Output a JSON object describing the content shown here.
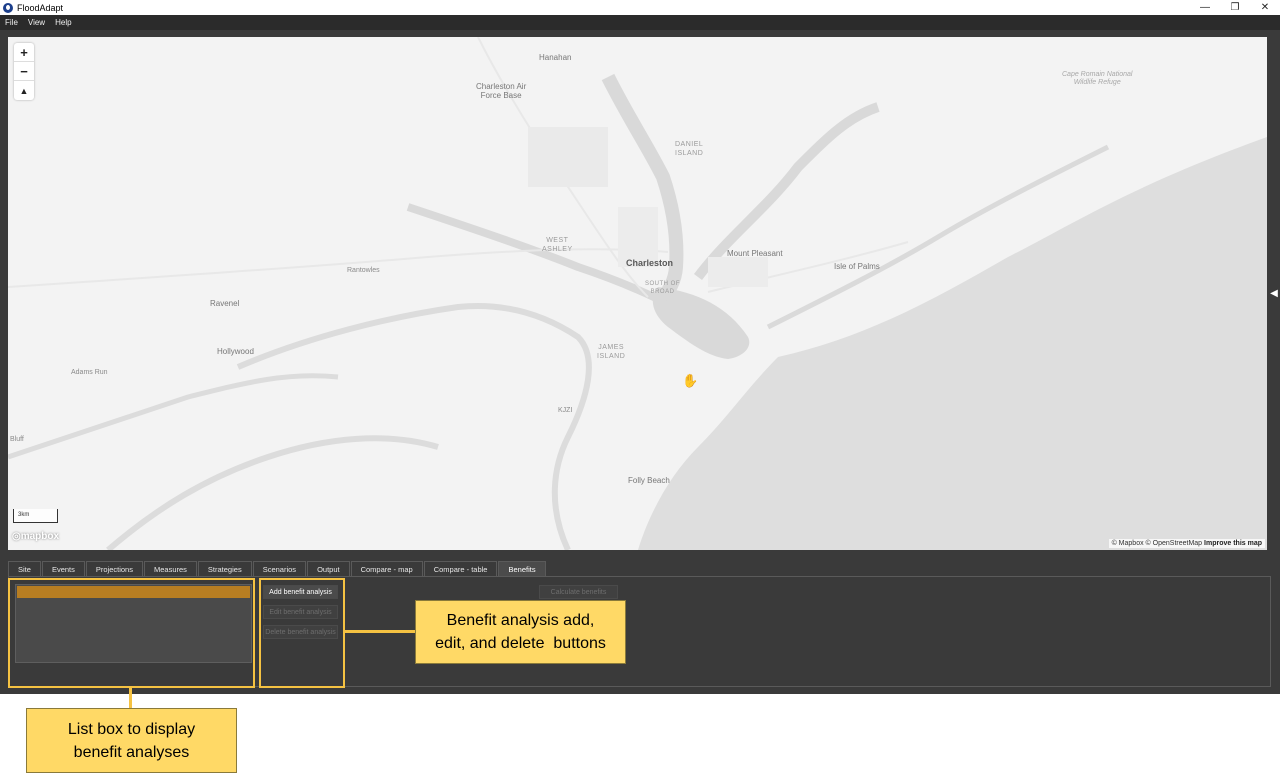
{
  "window": {
    "title": "FloodAdapt",
    "controls": {
      "minimize": "—",
      "maximize": "❐",
      "close": "✕"
    }
  },
  "menu": {
    "items": [
      "File",
      "View",
      "Help"
    ]
  },
  "map": {
    "zoom_in": "+",
    "zoom_out": "−",
    "compass": "▲",
    "scale_label": "3km",
    "logo_text": "◎mapbox",
    "attribution": {
      "mapbox": "© Mapbox",
      "osm": "© OpenStreetMap",
      "improve": "Improve this map"
    },
    "labels": {
      "hanahan": "Hanahan",
      "charleston_afb": "Charleston Air\nForce Base",
      "daniel_island": "DANIEL\nISLAND",
      "west_ashley": "WEST\nASHLEY",
      "charleston": "Charleston",
      "south_of_broad": "SOUTH OF\nBROAD",
      "mount_pleasant": "Mount Pleasant",
      "isle_of_palms": "Isle of Palms",
      "rantowles": "Rantowles",
      "ravenel": "Ravenel",
      "hollywood": "Hollywood",
      "adams_run": "Adams Run",
      "james_island": "JAMES\nISLAND",
      "kjzi": "KJZI",
      "folly_beach": "Folly Beach",
      "bluff": "Bluff",
      "cape_romain": "Cape Romain National\nWildlife Refuge"
    },
    "side_toggle": "◀"
  },
  "tabs": [
    "Site",
    "Events",
    "Projections",
    "Measures",
    "Strategies",
    "Scenarios",
    "Output",
    "Compare - map",
    "Compare - table",
    "Benefits"
  ],
  "active_tab": "Benefits",
  "benefits": {
    "add_button": "Add benefit analysis",
    "edit_button": "Edit benefit analysis",
    "delete_button": "Delete benefit analysis",
    "calculate_button": "Calculate benefits"
  },
  "annotations": {
    "buttons_callout": "Benefit analysis add,\nedit, and delete  buttons",
    "listbox_callout": "List box to display\nbenefit analyses"
  },
  "colors": {
    "background": "#3a3a3a",
    "selection": "#b87e22",
    "annotation": "#ffd966",
    "annotation_border": "#f5c242"
  }
}
